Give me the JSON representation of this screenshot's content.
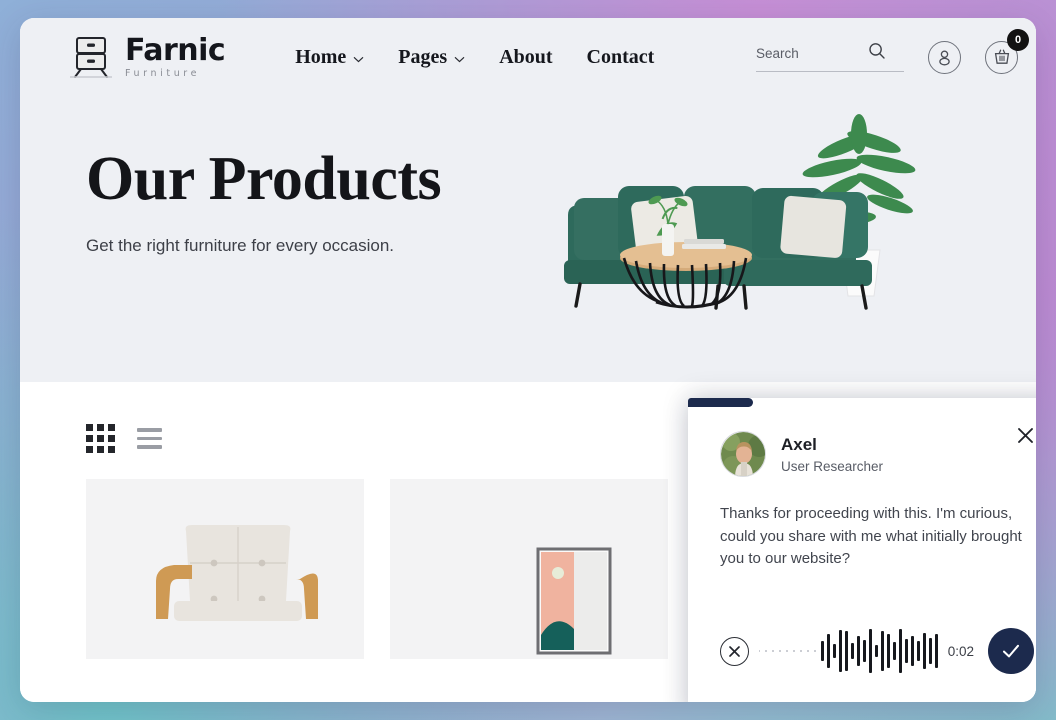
{
  "site": {
    "logo_name": "Farnic",
    "logo_sub": "Furniture",
    "logo_icon": "dresser-icon"
  },
  "nav": {
    "items": [
      {
        "label": "Home",
        "has_dropdown": true
      },
      {
        "label": "Pages",
        "has_dropdown": true
      },
      {
        "label": "About",
        "has_dropdown": false
      },
      {
        "label": "Contact",
        "has_dropdown": false
      }
    ]
  },
  "tools": {
    "search_placeholder": "Search",
    "search_value": "",
    "search_icon": "search-icon",
    "account_icon": "user-account-icon",
    "cart_icon": "shopping-basket-icon",
    "cart_count": "0"
  },
  "hero": {
    "title": "Our Products",
    "subtitle": "Get the right furniture for every occasion.",
    "artwork": "green-sectional-sofa-with-coffee-table-and-plant"
  },
  "products": {
    "view_grid_icon": "grid-view-icon",
    "view_list_icon": "list-view-icon",
    "active_view": "grid",
    "cards": [
      {
        "image": "beige-tufted-armchair-with-wooden-arms"
      },
      {
        "image": "framed-abstract-art-print"
      }
    ]
  },
  "survey": {
    "progress_percent": 18,
    "close_icon": "close-icon",
    "avatar_icon": "researcher-avatar",
    "name": "Axel",
    "role": "User Researcher",
    "question": "Thanks for proceeding with this. I'm curious, could you share with me what initially brought you to our website?",
    "recorder": {
      "cancel_icon": "cancel-recording-icon",
      "waveform_icon": "audio-waveform",
      "elapsed": "0:02",
      "submit_icon": "checkmark-icon",
      "accent_color": "#1c2a4d"
    }
  }
}
